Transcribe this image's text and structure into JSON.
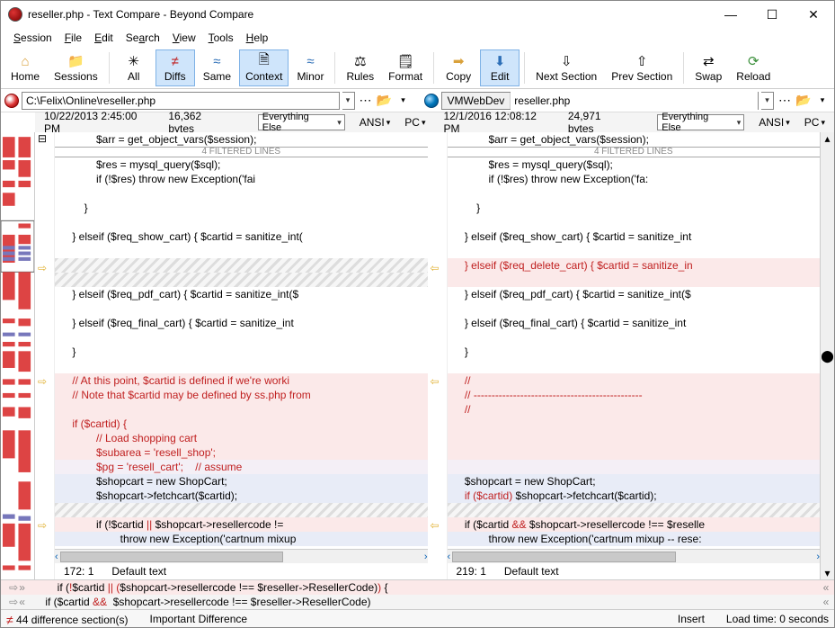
{
  "window": {
    "title": "reseller.php - Text Compare - Beyond Compare"
  },
  "menus": {
    "session": "Session",
    "file": "File",
    "edit": "Edit",
    "search": "Search",
    "view": "View",
    "tools": "Tools",
    "help": "Help"
  },
  "toolbar": {
    "home": "Home",
    "sessions": "Sessions",
    "all": "All",
    "diffs": "Diffs",
    "same": "Same",
    "context": "Context",
    "minor": "Minor",
    "rules": "Rules",
    "format": "Format",
    "copy": "Copy",
    "edit": "Edit",
    "nextsec": "Next Section",
    "prevsec": "Prev Section",
    "swap": "Swap",
    "reload": "Reload"
  },
  "left": {
    "path": "C:\\Felix\\Online\\reseller.php",
    "timestamp": "10/22/2013 2:45:00 PM",
    "bytes": "16,362 bytes",
    "mode": "Everything Else",
    "enc": "ANSI",
    "lineend": "PC",
    "cursor": "172: 1",
    "postext": "Default text"
  },
  "right": {
    "label": "VMWebDev",
    "file": "reseller.php",
    "timestamp": "12/1/2016 12:08:12 PM",
    "bytes": "24,971 bytes",
    "mode": "Everything Else",
    "enc": "ANSI",
    "lineend": "PC",
    "cursor": "219: 1",
    "postext": "Default text"
  },
  "filtered_label": "4 FILTERED LINES",
  "left_lines": [
    {
      "cls": "w",
      "txt": "            $arr = get_object_vars($session);"
    },
    {
      "cls": "filt"
    },
    {
      "cls": "w",
      "txt": "            $res = mysql_query($sql);"
    },
    {
      "cls": "w",
      "txt": "            if (!$res) throw new Exception('fai"
    },
    {
      "cls": "w",
      "txt": ""
    },
    {
      "cls": "w",
      "txt": "        }"
    },
    {
      "cls": "w",
      "txt": ""
    },
    {
      "cls": "w",
      "txt": "    } elseif ($req_show_cart) { $cartid = sanitize_int("
    },
    {
      "cls": "w",
      "txt": ""
    },
    {
      "cls": "strk",
      "txt": ""
    },
    {
      "cls": "strk",
      "txt": ""
    },
    {
      "cls": "w",
      "txt": "    } elseif ($req_pdf_cart) { $cartid = sanitize_int($"
    },
    {
      "cls": "w",
      "txt": ""
    },
    {
      "cls": "w",
      "txt": "    } elseif ($req_final_cart) { $cartid = sanitize_int"
    },
    {
      "cls": "w",
      "txt": ""
    },
    {
      "cls": "w",
      "txt": "    }"
    },
    {
      "cls": "w",
      "txt": ""
    },
    {
      "cls": "pk red",
      "txt": "    // At this point, $cartid is defined if we're worki"
    },
    {
      "cls": "pk red",
      "txt": "    // Note that $cartid may be defined by ss.php from"
    },
    {
      "cls": "pk red",
      "txt": ""
    },
    {
      "cls": "pk red",
      "txt": "    if ($cartid) {"
    },
    {
      "cls": "pk red",
      "txt": "            // Load shopping cart"
    },
    {
      "cls": "pk red",
      "txt": "            $subarea = 'resell_shop';"
    },
    {
      "cls": "dl red",
      "txt": "            $pg = 'resell_cart';    // assume"
    },
    {
      "cls": "lb",
      "txt": "            $shopcart = new ShopCart;"
    },
    {
      "cls": "lb",
      "txt": "            $shopcart->fetchcart($cartid);"
    },
    {
      "cls": "strk",
      "txt": ""
    },
    {
      "cls": "pk",
      "redparts": [
        "            if (!$cartid ",
        "||",
        " $shopcart->resellercode !="
      ]
    },
    {
      "cls": "lb",
      "txt": "                    throw new Exception('cartnum mixup"
    }
  ],
  "right_lines": [
    {
      "cls": "w",
      "txt": "            $arr = get_object_vars($session);"
    },
    {
      "cls": "filt"
    },
    {
      "cls": "w",
      "txt": "            $res = mysql_query($sql);"
    },
    {
      "cls": "w",
      "txt": "            if (!$res) throw new Exception('fa:"
    },
    {
      "cls": "w",
      "txt": ""
    },
    {
      "cls": "w",
      "txt": "        }"
    },
    {
      "cls": "w",
      "txt": ""
    },
    {
      "cls": "w",
      "txt": "    } elseif ($req_show_cart) { $cartid = sanitize_int"
    },
    {
      "cls": "w",
      "txt": ""
    },
    {
      "cls": "pk red",
      "txt": "    } elseif ($req_delete_cart) { $cartid = sanitize_in"
    },
    {
      "cls": "pk",
      "txt": ""
    },
    {
      "cls": "w",
      "txt": "    } elseif ($req_pdf_cart) { $cartid = sanitize_int($"
    },
    {
      "cls": "w",
      "txt": ""
    },
    {
      "cls": "w",
      "txt": "    } elseif ($req_final_cart) { $cartid = sanitize_int"
    },
    {
      "cls": "w",
      "txt": ""
    },
    {
      "cls": "w",
      "txt": "    }"
    },
    {
      "cls": "w",
      "txt": ""
    },
    {
      "cls": "pk red",
      "txt": "    //"
    },
    {
      "cls": "pk red",
      "txt": "    // -----------------------------------------------"
    },
    {
      "cls": "pk red",
      "txt": "    //"
    },
    {
      "cls": "pk",
      "txt": ""
    },
    {
      "cls": "pk",
      "txt": ""
    },
    {
      "cls": "pk",
      "txt": ""
    },
    {
      "cls": "dl",
      "txt": ""
    },
    {
      "cls": "lb",
      "txt": "    $shopcart = new ShopCart;"
    },
    {
      "cls": "lb",
      "redparts": [
        "    ",
        "if ($cartid) ",
        "$shopcart->fetchcart($cartid);"
      ]
    },
    {
      "cls": "strk",
      "txt": ""
    },
    {
      "cls": "pk",
      "redparts": [
        "    if ($cartid ",
        "&&",
        " $shopcart->resellercode !== $reselle"
      ]
    },
    {
      "cls": "lb",
      "txt": "            throw new Exception('cartnum mixup -- rese:"
    }
  ],
  "merge": {
    "l1": "        if (!$cartid || ($shopcart->resellercode !== $reseller->ResellerCode)) {",
    "l2": "    if ($cartid &&  $shopcart->resellercode !== $reseller->ResellerCode)"
  },
  "status": {
    "diffcount": "44 difference section(s)",
    "impdiff": "Important Difference",
    "ins": "Insert",
    "load": "Load time: 0 seconds"
  }
}
